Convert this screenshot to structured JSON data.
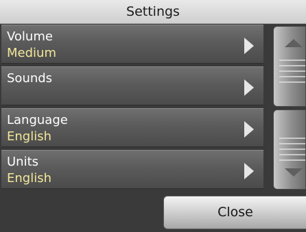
{
  "window": {
    "title": "Settings"
  },
  "settings": {
    "items": [
      {
        "label": "Volume",
        "value": "Medium",
        "icon": "chevron-right-icon"
      },
      {
        "label": "Sounds",
        "value": "",
        "icon": "chevron-right-icon"
      },
      {
        "label": "Language",
        "value": "English",
        "icon": "chevron-right-icon"
      },
      {
        "label": "Units",
        "value": "English",
        "icon": "chevron-right-icon"
      }
    ]
  },
  "scrollbar": {
    "up_icon": "triangle-up-icon",
    "down_icon": "triangle-down-icon"
  },
  "footer": {
    "close_label": "Close"
  },
  "colors": {
    "value_text": "#f3e79a",
    "label_text": "#ffffff",
    "background": "#3a3a3a"
  }
}
